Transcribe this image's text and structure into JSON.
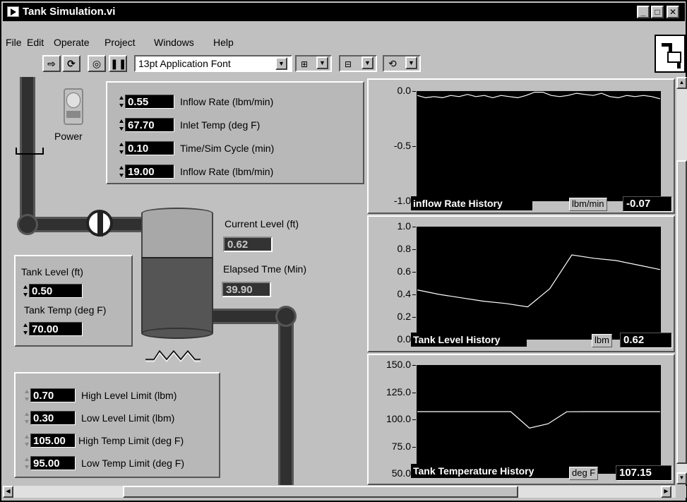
{
  "window": {
    "title": "Tank Simulation.vi"
  },
  "menu": [
    "File",
    "Edit",
    "Operate",
    "Project",
    "Windows",
    "Help"
  ],
  "toolbar": {
    "font": "13pt Application Font"
  },
  "power": {
    "label": "Power"
  },
  "sim_controls": [
    {
      "value": "0.55",
      "label": "Inflow Rate (lbm/min)"
    },
    {
      "value": "67.70",
      "label": "Inlet Temp (deg F)"
    },
    {
      "value": "0.10",
      "label": "Time/Sim Cycle (min)"
    },
    {
      "value": "19.00",
      "label": "Inflow Rate (lbm/min)"
    }
  ],
  "tank_init": {
    "level_label": "Tank Level (ft)",
    "level_value": "0.50",
    "temp_label": "Tank Temp (deg F)",
    "temp_value": "70.00"
  },
  "current_level": {
    "label": "Current Level (ft)",
    "value": "0.62"
  },
  "elapsed": {
    "label": "Elapsed Tme (Min)",
    "value": "39.90"
  },
  "limits": [
    {
      "value": "0.70",
      "label": "High Level Limit (lbm)"
    },
    {
      "value": "0.30",
      "label": "Low Level Limit (lbm)"
    },
    {
      "value": "105.00",
      "label": "High Temp Limit (deg F)"
    },
    {
      "value": "95.00",
      "label": "Low Temp Limit (deg F)"
    }
  ],
  "charts": [
    {
      "title": "Inflow Rate History",
      "unit": "lbm/min",
      "value": "-0.07"
    },
    {
      "title": "Tank Level History",
      "unit": "lbm",
      "value": "0.62"
    },
    {
      "title": "Tank Temperature History",
      "unit": "deg F",
      "value": "107.15"
    }
  ],
  "chart_data": [
    {
      "type": "line",
      "title": "Inflow Rate History",
      "ylim": [
        -1.0,
        0.0
      ],
      "yticks": [
        "0.0",
        "-0.5",
        "-1.0"
      ],
      "series": [
        {
          "values": [
            -0.04,
            -0.06,
            -0.05,
            -0.06,
            -0.04,
            -0.05,
            -0.03,
            -0.05,
            -0.04,
            -0.06,
            -0.04,
            -0.05,
            -0.06,
            -0.04,
            -0.01,
            -0.01,
            -0.04,
            -0.05,
            -0.04,
            -0.02,
            -0.03,
            -0.04,
            -0.02,
            -0.05,
            -0.06,
            -0.04,
            -0.05,
            -0.04,
            -0.05,
            -0.07
          ]
        }
      ]
    },
    {
      "type": "line",
      "title": "Tank Level History",
      "ylim": [
        0.0,
        1.0
      ],
      "yticks": [
        "1.0",
        "0.8",
        "0.6",
        "0.4",
        "0.2",
        "0.0"
      ],
      "series": [
        {
          "values": [
            0.44,
            0.4,
            0.37,
            0.34,
            0.32,
            0.29,
            0.45,
            0.75,
            0.72,
            0.7,
            0.66,
            0.62
          ]
        }
      ]
    },
    {
      "type": "line",
      "title": "Tank Temperature History",
      "ylim": [
        50.0,
        150.0
      ],
      "yticks": [
        "150.0",
        "125.0",
        "100.0",
        "75.0",
        "50.0"
      ],
      "series": [
        {
          "values": [
            107.15,
            107.15,
            107.15,
            107.15,
            107.15,
            107.15,
            92.0,
            96.0,
            107.0,
            107.15,
            107.15,
            107.15,
            107.15,
            107.15
          ]
        }
      ]
    }
  ]
}
